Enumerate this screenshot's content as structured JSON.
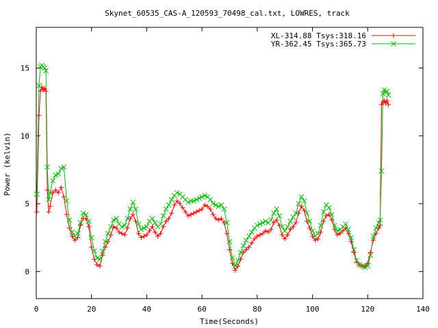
{
  "chart_data": {
    "type": "scatter",
    "title": "Skynet_60535_CAS-A_120593_70498_cal.txt, LOWRES, track",
    "xlabel": "Time(Seconds)",
    "ylabel": "Power (kelvin)",
    "xlim": [
      0,
      140
    ],
    "ylim": [
      -2,
      18
    ],
    "xticks": [
      0,
      20,
      40,
      60,
      80,
      100,
      120,
      140
    ],
    "yticks": [
      0,
      5,
      10,
      15
    ],
    "grid": false,
    "legend_position": "top-right",
    "series": [
      {
        "name": "XL-314.88 Tsys:318.16",
        "color": "#ff0000",
        "marker": "plus",
        "points": [
          [
            0.2,
            4.4
          ],
          [
            1.0,
            11.5
          ],
          [
            1.5,
            13.3
          ],
          [
            2.0,
            13.6
          ],
          [
            2.5,
            13.4
          ],
          [
            3.0,
            13.5
          ],
          [
            3.5,
            13.3
          ],
          [
            4.0,
            6.0
          ],
          [
            4.5,
            4.4
          ],
          [
            5,
            4.8
          ],
          [
            6,
            5.8
          ],
          [
            7,
            6.0
          ],
          [
            8,
            5.8
          ],
          [
            9,
            6.2
          ],
          [
            10,
            5.5
          ],
          [
            11,
            4.2
          ],
          [
            12,
            3.2
          ],
          [
            13,
            2.6
          ],
          [
            14,
            2.3
          ],
          [
            15,
            2.5
          ],
          [
            16,
            3.4
          ],
          [
            17,
            3.9
          ],
          [
            18,
            3.9
          ],
          [
            19,
            3.3
          ],
          [
            20,
            1.8
          ],
          [
            21,
            0.9
          ],
          [
            22,
            0.5
          ],
          [
            23,
            0.4
          ],
          [
            24,
            1.2
          ],
          [
            25,
            1.8
          ],
          [
            26,
            2.2
          ],
          [
            27,
            2.7
          ],
          [
            28,
            3.3
          ],
          [
            29,
            3.2
          ],
          [
            30,
            2.9
          ],
          [
            31,
            2.8
          ],
          [
            32,
            2.7
          ],
          [
            33,
            3.2
          ],
          [
            34,
            3.9
          ],
          [
            35,
            4.2
          ],
          [
            36,
            3.7
          ],
          [
            37,
            2.8
          ],
          [
            38,
            2.5
          ],
          [
            39,
            2.6
          ],
          [
            40,
            2.7
          ],
          [
            41,
            3.0
          ],
          [
            42,
            3.3
          ],
          [
            43,
            2.9
          ],
          [
            44,
            2.6
          ],
          [
            45,
            2.8
          ],
          [
            46,
            3.3
          ],
          [
            47,
            3.7
          ],
          [
            48,
            3.9
          ],
          [
            49,
            4.3
          ],
          [
            50,
            4.9
          ],
          [
            51,
            5.2
          ],
          [
            52,
            5.0
          ],
          [
            53,
            4.7
          ],
          [
            54,
            4.4
          ],
          [
            55,
            4.1
          ],
          [
            56,
            4.2
          ],
          [
            57,
            4.3
          ],
          [
            58,
            4.4
          ],
          [
            59,
            4.5
          ],
          [
            60,
            4.6
          ],
          [
            61,
            4.9
          ],
          [
            62,
            4.8
          ],
          [
            63,
            4.6
          ],
          [
            64,
            4.2
          ],
          [
            65,
            3.9
          ],
          [
            66,
            3.8
          ],
          [
            67,
            3.9
          ],
          [
            68,
            3.6
          ],
          [
            69,
            2.8
          ],
          [
            70,
            1.6
          ],
          [
            71,
            0.6
          ],
          [
            72,
            0.1
          ],
          [
            73,
            0.4
          ],
          [
            74,
            0.9
          ],
          [
            75,
            1.4
          ],
          [
            76,
            1.6
          ],
          [
            77,
            1.8
          ],
          [
            78,
            2.1
          ],
          [
            79,
            2.4
          ],
          [
            80,
            2.6
          ],
          [
            81,
            2.7
          ],
          [
            82,
            2.8
          ],
          [
            83,
            3.0
          ],
          [
            84,
            2.9
          ],
          [
            85,
            3.1
          ],
          [
            86,
            3.6
          ],
          [
            87,
            3.8
          ],
          [
            88,
            3.4
          ],
          [
            89,
            2.7
          ],
          [
            90,
            2.4
          ],
          [
            91,
            2.7
          ],
          [
            92,
            3.1
          ],
          [
            93,
            3.3
          ],
          [
            94,
            3.6
          ],
          [
            95,
            4.3
          ],
          [
            96,
            4.8
          ],
          [
            97,
            4.5
          ],
          [
            98,
            3.7
          ],
          [
            99,
            3.2
          ],
          [
            100,
            2.6
          ],
          [
            101,
            2.3
          ],
          [
            102,
            2.4
          ],
          [
            103,
            2.9
          ],
          [
            104,
            3.7
          ],
          [
            105,
            4.1
          ],
          [
            106,
            4.2
          ],
          [
            107,
            3.8
          ],
          [
            108,
            3.1
          ],
          [
            109,
            2.7
          ],
          [
            110,
            2.8
          ],
          [
            111,
            3.0
          ],
          [
            112,
            3.2
          ],
          [
            113,
            2.8
          ],
          [
            114,
            2.2
          ],
          [
            115,
            1.4
          ],
          [
            116,
            0.7
          ],
          [
            117,
            0.5
          ],
          [
            118,
            0.4
          ],
          [
            119,
            0.4
          ],
          [
            120,
            0.6
          ],
          [
            121,
            1.4
          ],
          [
            122,
            2.3
          ],
          [
            123,
            2.8
          ],
          [
            124,
            3.2
          ],
          [
            124.5,
            3.4
          ],
          [
            125.0,
            12.3
          ],
          [
            125.5,
            12.5
          ],
          [
            126,
            12.6
          ],
          [
            126.5,
            12.4
          ],
          [
            127,
            12.6
          ],
          [
            127.5,
            12.3
          ]
        ]
      },
      {
        "name": "YR-362.45 Tsys:365.73",
        "color": "#00c000",
        "marker": "x",
        "points": [
          [
            0.2,
            5.7
          ],
          [
            1.0,
            13.7
          ],
          [
            1.5,
            15.1
          ],
          [
            2.0,
            15.2
          ],
          [
            2.5,
            15.1
          ],
          [
            3.0,
            15.0
          ],
          [
            3.5,
            14.8
          ],
          [
            4.0,
            7.7
          ],
          [
            4.5,
            5.3
          ],
          [
            5,
            5.8
          ],
          [
            6,
            6.7
          ],
          [
            7,
            7.1
          ],
          [
            8,
            7.2
          ],
          [
            9,
            7.6
          ],
          [
            10,
            7.7
          ],
          [
            11,
            5.2
          ],
          [
            12,
            3.8
          ],
          [
            13,
            2.9
          ],
          [
            14,
            2.6
          ],
          [
            15,
            2.8
          ],
          [
            16,
            3.6
          ],
          [
            17,
            4.3
          ],
          [
            18,
            4.2
          ],
          [
            19,
            3.7
          ],
          [
            20,
            2.5
          ],
          [
            21,
            1.5
          ],
          [
            22,
            1.0
          ],
          [
            23,
            0.9
          ],
          [
            24,
            1.5
          ],
          [
            25,
            2.2
          ],
          [
            26,
            2.8
          ],
          [
            27,
            3.3
          ],
          [
            28,
            3.8
          ],
          [
            29,
            3.9
          ],
          [
            30,
            3.5
          ],
          [
            31,
            3.3
          ],
          [
            32,
            3.4
          ],
          [
            33,
            3.9
          ],
          [
            34,
            4.6
          ],
          [
            35,
            5.1
          ],
          [
            36,
            4.6
          ],
          [
            37,
            3.5
          ],
          [
            38,
            3.1
          ],
          [
            39,
            3.2
          ],
          [
            40,
            3.3
          ],
          [
            41,
            3.7
          ],
          [
            42,
            3.9
          ],
          [
            43,
            3.6
          ],
          [
            44,
            3.3
          ],
          [
            45,
            3.5
          ],
          [
            46,
            4.1
          ],
          [
            47,
            4.6
          ],
          [
            48,
            4.9
          ],
          [
            49,
            5.3
          ],
          [
            50,
            5.6
          ],
          [
            51,
            5.8
          ],
          [
            52,
            5.7
          ],
          [
            53,
            5.5
          ],
          [
            54,
            5.3
          ],
          [
            55,
            5.1
          ],
          [
            56,
            5.2
          ],
          [
            57,
            5.2
          ],
          [
            58,
            5.3
          ],
          [
            59,
            5.4
          ],
          [
            60,
            5.5
          ],
          [
            61,
            5.6
          ],
          [
            62,
            5.5
          ],
          [
            63,
            5.3
          ],
          [
            64,
            5.0
          ],
          [
            65,
            4.9
          ],
          [
            66,
            4.8
          ],
          [
            67,
            4.9
          ],
          [
            68,
            4.6
          ],
          [
            69,
            3.6
          ],
          [
            70,
            2.2
          ],
          [
            71,
            1.0
          ],
          [
            72,
            0.4
          ],
          [
            73,
            0.8
          ],
          [
            74,
            1.4
          ],
          [
            75,
            1.9
          ],
          [
            76,
            2.3
          ],
          [
            77,
            2.6
          ],
          [
            78,
            2.9
          ],
          [
            79,
            3.2
          ],
          [
            80,
            3.4
          ],
          [
            81,
            3.5
          ],
          [
            82,
            3.6
          ],
          [
            83,
            3.7
          ],
          [
            84,
            3.6
          ],
          [
            85,
            3.8
          ],
          [
            86,
            4.3
          ],
          [
            87,
            4.6
          ],
          [
            88,
            4.1
          ],
          [
            89,
            3.3
          ],
          [
            90,
            3.0
          ],
          [
            91,
            3.3
          ],
          [
            92,
            3.7
          ],
          [
            93,
            4.0
          ],
          [
            94,
            4.3
          ],
          [
            95,
            5.0
          ],
          [
            96,
            5.5
          ],
          [
            97,
            5.2
          ],
          [
            98,
            4.3
          ],
          [
            99,
            3.7
          ],
          [
            100,
            3.0
          ],
          [
            101,
            2.6
          ],
          [
            102,
            2.8
          ],
          [
            103,
            3.4
          ],
          [
            104,
            4.4
          ],
          [
            105,
            4.9
          ],
          [
            106,
            4.7
          ],
          [
            107,
            4.2
          ],
          [
            108,
            3.4
          ],
          [
            109,
            3.0
          ],
          [
            110,
            3.1
          ],
          [
            111,
            3.3
          ],
          [
            112,
            3.5
          ],
          [
            113,
            3.1
          ],
          [
            114,
            2.5
          ],
          [
            115,
            1.6
          ],
          [
            116,
            0.8
          ],
          [
            117,
            0.5
          ],
          [
            118,
            0.4
          ],
          [
            119,
            0.3
          ],
          [
            120,
            0.4
          ],
          [
            121,
            1.2
          ],
          [
            122,
            2.6
          ],
          [
            123,
            3.2
          ],
          [
            124,
            3.6
          ],
          [
            124.5,
            3.8
          ],
          [
            125.0,
            7.4
          ],
          [
            125.5,
            13.1
          ],
          [
            126,
            13.4
          ],
          [
            126.5,
            13.2
          ],
          [
            127,
            13.3
          ],
          [
            127.5,
            13.0
          ]
        ]
      }
    ]
  }
}
